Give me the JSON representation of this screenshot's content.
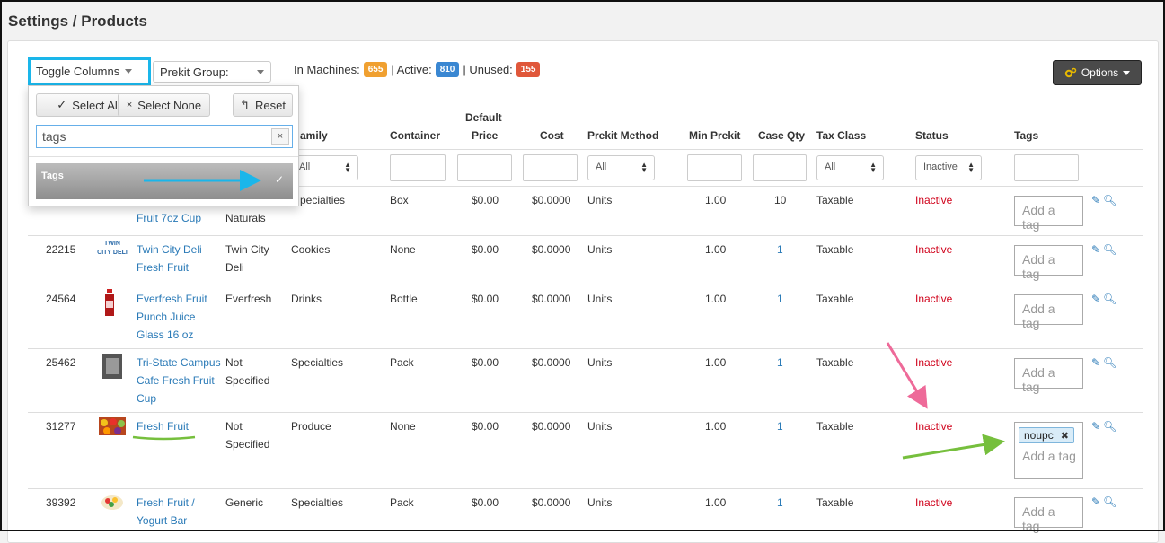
{
  "page": {
    "title": "Settings / Products"
  },
  "toolbar": {
    "toggle_columns": "Toggle Columns",
    "prekit_group": "Prekit Group:",
    "stats": {
      "in_machines_label": "In Machines:",
      "in_machines": "655",
      "active_label": "| Active:",
      "active": "810",
      "unused_label": "| Unused:",
      "unused": "155",
      "sep": "|"
    },
    "options": "Options"
  },
  "dropdown": {
    "select_all": "Select All",
    "select_none": "Select None",
    "reset": "Reset",
    "search_value": "tags",
    "clear": "×",
    "option": "Tags",
    "check": "✓"
  },
  "columns": {
    "family": "amily",
    "container": "Container",
    "default_price_1": "Default",
    "default_price_2": "Price",
    "cost": "Cost",
    "prekit_method": "Prekit Method",
    "min_prekit": "Min Prekit",
    "case_qty": "Case Qty",
    "tax_class": "Tax Class",
    "status": "Status",
    "tags": "Tags"
  },
  "filters": {
    "family": "All",
    "prekit_method": "All",
    "tax_class": "All",
    "status": "Inactive"
  },
  "rows": [
    {
      "id": "",
      "name": [
        "Fruit 7oz Cup"
      ],
      "brand": [
        "Naturals"
      ],
      "family": "pecialties",
      "container": "Box",
      "price": "$0.00",
      "cost": "$0.0000",
      "method": "Units",
      "min": "1.00",
      "qty": "10",
      "tax": "Taxable",
      "status": "Inactive",
      "tag_placeholder": "Add a tag"
    },
    {
      "id": "22215",
      "name": [
        "Twin City Deli",
        "Fresh Fruit"
      ],
      "brand": [
        "Twin City",
        "Deli"
      ],
      "logo": [
        "TWIN",
        "CITY DELI"
      ],
      "family": "Cookies",
      "container": "None",
      "price": "$0.00",
      "cost": "$0.0000",
      "method": "Units",
      "min": "1.00",
      "qty": "1",
      "tax": "Taxable",
      "status": "Inactive",
      "tag_placeholder": "Add a tag"
    },
    {
      "id": "24564",
      "name": [
        "Everfresh Fruit",
        "Punch Juice",
        "Glass 16 oz"
      ],
      "brand": [
        "Everfresh"
      ],
      "family": "Drinks",
      "container": "Bottle",
      "price": "$0.00",
      "cost": "$0.0000",
      "method": "Units",
      "min": "1.00",
      "qty": "1",
      "tax": "Taxable",
      "status": "Inactive",
      "tag_placeholder": "Add a tag"
    },
    {
      "id": "25462",
      "name": [
        "Tri-State Campus",
        "Cafe Fresh Fruit",
        "Cup"
      ],
      "brand": [
        "Not",
        "Specified"
      ],
      "family": "Specialties",
      "container": "Pack",
      "price": "$0.00",
      "cost": "$0.0000",
      "method": "Units",
      "min": "1.00",
      "qty": "1",
      "tax": "Taxable",
      "status": "Inactive",
      "tag_placeholder": "Add a tag"
    },
    {
      "id": "31277",
      "name": [
        "Fresh Fruit"
      ],
      "brand": [
        "Not",
        "Specified"
      ],
      "family": "Produce",
      "container": "None",
      "price": "$0.00",
      "cost": "$0.0000",
      "method": "Units",
      "min": "1.00",
      "qty": "1",
      "tax": "Taxable",
      "status": "Inactive",
      "tag_chip": "noupc",
      "tag_chip_remove": "✖",
      "tag_placeholder": "Add a tag"
    },
    {
      "id": "39392",
      "name": [
        "Fresh Fruit /",
        "Yogurt Bar"
      ],
      "brand": [
        "Generic"
      ],
      "family": "Specialties",
      "container": "Pack",
      "price": "$0.00",
      "cost": "$0.0000",
      "method": "Units",
      "min": "1.00",
      "qty": "1",
      "tax": "Taxable",
      "status": "Inactive",
      "tag_placeholder": "Add a tag"
    }
  ],
  "icons": {
    "edit": "pencil-icon",
    "view": "magnifier-icon",
    "options": "gears-icon"
  },
  "colors": {
    "in_machines": "#f0a030",
    "active": "#3a87d2",
    "unused": "#e0573a",
    "accent": "#1ab6ea",
    "link": "#2a7ab7",
    "inactive": "#d0021b"
  }
}
